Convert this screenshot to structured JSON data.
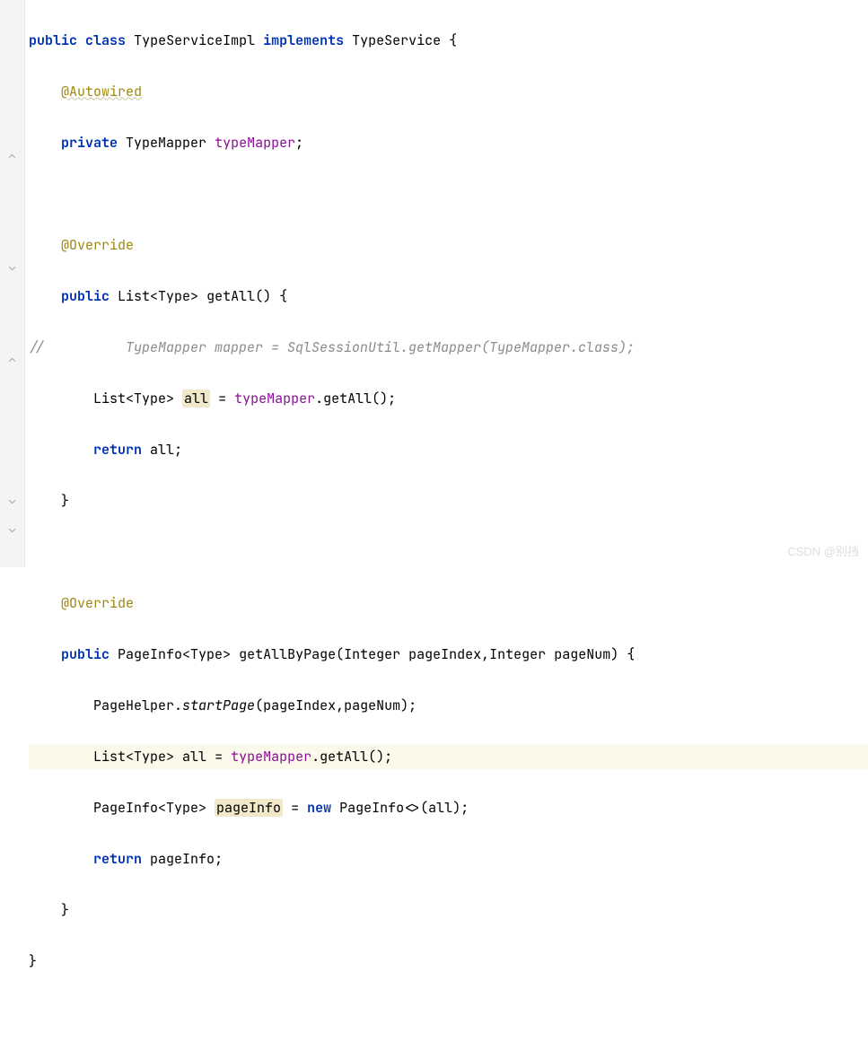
{
  "code": {
    "l1": {
      "kw_public": "public",
      "kw_class": "class",
      "cls": "TypeServiceImpl",
      "kw_impl": "implements",
      "iface": "TypeService",
      "brace": "{"
    },
    "l2": {
      "anno": "@Autowired"
    },
    "l3": {
      "kw_private": "private",
      "type": "TypeMapper",
      "field": "typeMapper",
      "semi": ";"
    },
    "l5": {
      "anno": "@Override"
    },
    "l6": {
      "kw_public": "public",
      "ret": "List<Type>",
      "method": "getAll",
      "paren": "()",
      "brace": "{"
    },
    "l7": {
      "comment_prefix": "//",
      "comment": "          TypeMapper mapper = SqlSessionUtil.getMapper(TypeMapper.class);"
    },
    "l8": {
      "type": "List<Type>",
      "var": "all",
      "eq": "=",
      "field": "typeMapper",
      "dot": ".",
      "method": "getAll",
      "paren": "()",
      "semi": ";"
    },
    "l9": {
      "kw_return": "return",
      "var": "all",
      "semi": ";"
    },
    "l10": {
      "brace": "}"
    },
    "l12": {
      "anno": "@Override"
    },
    "l13": {
      "kw_public": "public",
      "ret": "PageInfo<Type>",
      "method": "getAllByPage",
      "lparen": "(",
      "p1type": "Integer",
      "p1name": "pageIndex",
      "comma": ",",
      "p2type": "Integer",
      "p2name": "pageNum",
      "rparen": ")",
      "brace": "{"
    },
    "l14": {
      "cls": "PageHelper",
      "dot": ".",
      "method": "startPage",
      "lparen": "(",
      "p1": "pageIndex",
      "comma": ",",
      "p2": "pageNum",
      "rparen": ")",
      "semi": ";"
    },
    "l15": {
      "type": "List<Type>",
      "var": "all",
      "eq": "=",
      "field": "typeMapper",
      "dot": ".",
      "method": "getAll",
      "paren": "()",
      "semi": ";"
    },
    "l16": {
      "type": "PageInfo<Type>",
      "var": "pageInfo",
      "eq": "=",
      "kw_new": "new",
      "ctor": "PageInfo<>",
      "lparen": "(",
      "arg": "all",
      "rparen": ")",
      "semi": ";"
    },
    "l17": {
      "kw_return": "return",
      "var": "pageInfo",
      "semi": ";"
    },
    "l18": {
      "brace": "}"
    },
    "l19": {
      "brace": "}"
    }
  },
  "watermark": "CSDN @别挡"
}
